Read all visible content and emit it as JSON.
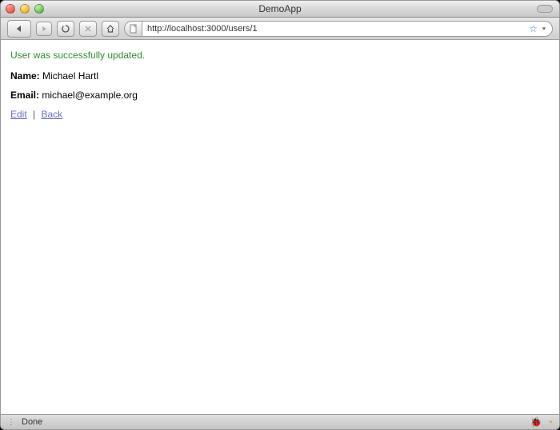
{
  "window": {
    "title": "DemoApp"
  },
  "addressbar": {
    "url": "http://localhost:3000/users/1"
  },
  "page": {
    "flash_message": "User was successfully updated.",
    "name_label": "Name:",
    "name_value": "Michael Hartl",
    "email_label": "Email:",
    "email_value": "michael@example.org",
    "edit_link": "Edit",
    "back_link": "Back",
    "link_separator": "|"
  },
  "status": {
    "text": "Done"
  }
}
